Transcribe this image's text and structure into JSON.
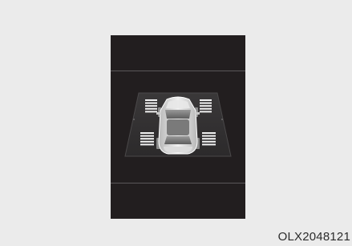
{
  "figure_code": "OLX2048121",
  "colors": {
    "page_bg": "#ebebeb",
    "panel_bg": "#221e1f",
    "floor": "#3d3b3d",
    "sensor_bar": "#f2f2f2",
    "car_body": "#d9d9d9"
  },
  "icons": [
    "parking-sensor-display-icon",
    "car-top-view-icon"
  ],
  "sensor_zones": [
    {
      "id": "front-left",
      "level": 5
    },
    {
      "id": "front-right",
      "level": 5
    },
    {
      "id": "rear-left",
      "level": 5
    },
    {
      "id": "rear-right",
      "level": 5
    }
  ]
}
